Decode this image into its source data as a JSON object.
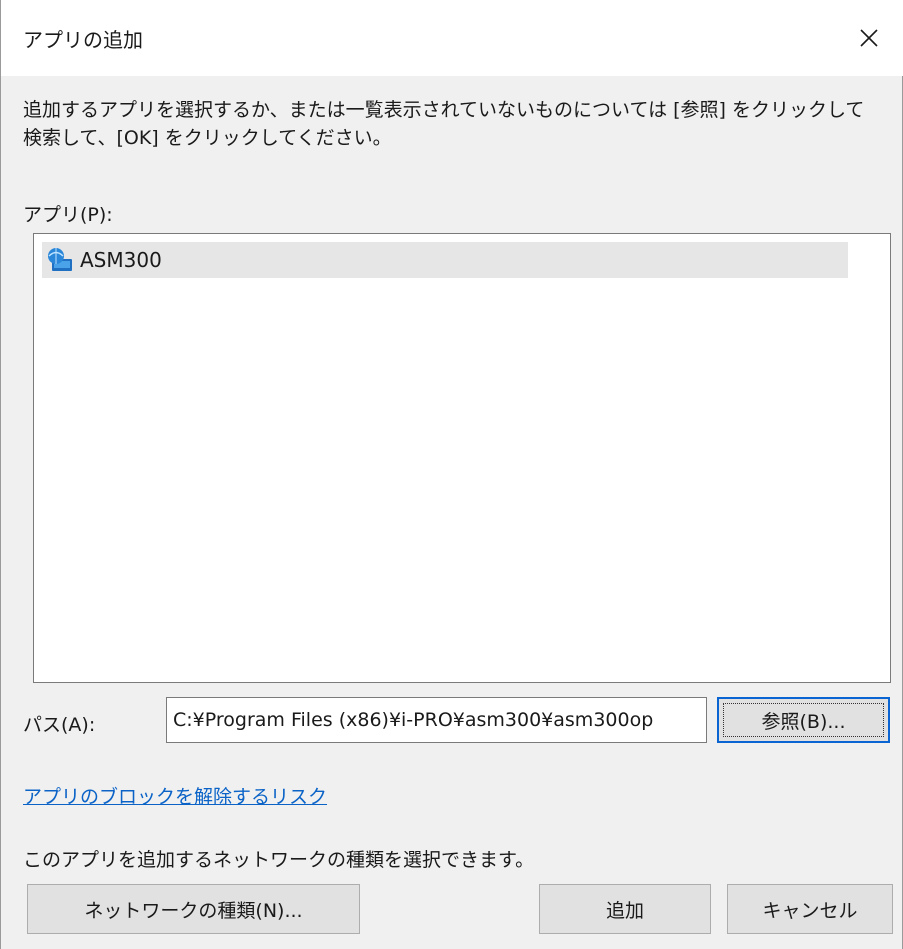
{
  "dialog": {
    "title": "アプリの追加",
    "close_icon": "close-icon"
  },
  "instruction": "追加するアプリを選択するか、または一覧表示されていないものについては [参照] をクリックして検索して、[OK] をクリックしてください。",
  "apps": {
    "label": "アプリ(P):",
    "items": [
      {
        "name": "ASM300",
        "icon": "network-app-icon",
        "selected": true
      }
    ]
  },
  "path": {
    "label": "パス(A):",
    "value": "C:¥Program Files (x86)¥i-PRO¥asm300¥asm300op"
  },
  "buttons": {
    "browse": "参照(B)...",
    "network_type": "ネットワークの種類(N)...",
    "add": "追加",
    "cancel": "キャンセル"
  },
  "risk_link": "アプリのブロックを解除するリスク",
  "network_text": "このアプリを追加するネットワークの種類を選択できます。",
  "colors": {
    "link": "#0b63c7",
    "focus_border": "#0a64d2",
    "dialog_bg": "#f0f0f0",
    "selected_row": "#e6e6e6"
  }
}
